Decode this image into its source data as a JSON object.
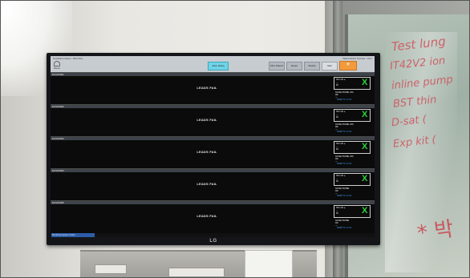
{
  "monitor": {
    "brand": "LG",
    "header": {
      "title": "Surveillance System · Ward View",
      "info": "Patient Monitor Overview · Unit 1",
      "alarm_label": "Silence",
      "center_button": "Alarm Setting",
      "tabs": [
        "Other Patients",
        "Review",
        "Standby",
        "Main"
      ]
    },
    "beds": [
      {
        "id": "ECG00001",
        "message": "LEADS FAIL",
        "side_top": "HR 1:60 ●",
        "side_mid": "---\n60",
        "status": "NOISE PROBE OFF\nRR\n---",
        "temp": "TEMP T1 1.6 T2"
      },
      {
        "id": "ECG00002",
        "message": "LEADS FAIL",
        "side_top": "HR 1:60 ●",
        "side_mid": "---\n60",
        "status": "NOISE PROBE OFF\nRR\n---",
        "temp": "TEMP T1 1.6 T2"
      },
      {
        "id": "ECG00003",
        "message": "LEADS FAIL",
        "side_top": "HR 1:60 ●",
        "side_mid": "---\n60",
        "status": "NOISE PROBE OFF\nRR\n---",
        "temp": "TEMP T1 1.6 T2"
      },
      {
        "id": "ECG00004",
        "message": "LEADS FAIL",
        "side_top": "HR 1:60 ●",
        "side_mid": "---\n60",
        "status": "NOISE PROBE\nRR\n---",
        "temp": "TEMP T1 1.6 T2"
      },
      {
        "id": "ECG00005",
        "message": "LEADS FAIL",
        "side_top": "HR 1:60 ●",
        "side_mid": "---\n60",
        "status": "NOISE PROBE\nRR\n---",
        "temp": "TEMP T1 1.6 T2"
      }
    ],
    "bottom_status": "Monitoring System Online"
  },
  "glass_notes": [
    "Test lung",
    "IT42V2 ion",
    "inline pump",
    "BST thin",
    "D-sat (",
    "Exp kit ("
  ],
  "glass_note_bottom": "* 박",
  "colors": {
    "x_mark": "#2fd13a",
    "center_button": "#6fd3e6",
    "alarm_button": "#f39b3b",
    "temp_text": "#4aa3ff",
    "note_marker": "#d0505a"
  }
}
